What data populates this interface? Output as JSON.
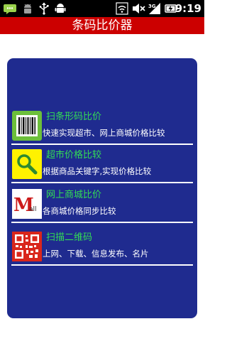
{
  "status_bar": {
    "time": "9:19",
    "icons": [
      "talk-notification-icon",
      "android-notification-icon",
      "usb-icon",
      "android-debug-icon",
      "wifi-icon",
      "mute-icon",
      "3g-signal-icon",
      "battery-charging-icon"
    ]
  },
  "app": {
    "title": "条码比价器"
  },
  "menu": {
    "items": [
      {
        "title": "扫条形码比价",
        "desc": "快速实现超市、网上商城价格比较",
        "icon": "barcode-icon",
        "title_color": "#33dd55"
      },
      {
        "title": "超市价格比较",
        "desc": "根据商品关键字,实现价格比较",
        "icon": "magnifier-icon",
        "title_color": "#33dd55"
      },
      {
        "title": "网上商城比价",
        "desc": "各商城价格同步比较",
        "icon": "mall-logo-icon",
        "title_color": "#33dd55",
        "icon_text_big": "M",
        "icon_text_small": "all"
      },
      {
        "title": "扫描二维码",
        "desc": "上网、下载、信息发布、名片",
        "icon": "qrcode-icon",
        "title_color": "#33dd55"
      }
    ]
  },
  "colors": {
    "title_bar": "#cc0000",
    "panel": "#1f2b8f",
    "status_bar": "#000000"
  }
}
